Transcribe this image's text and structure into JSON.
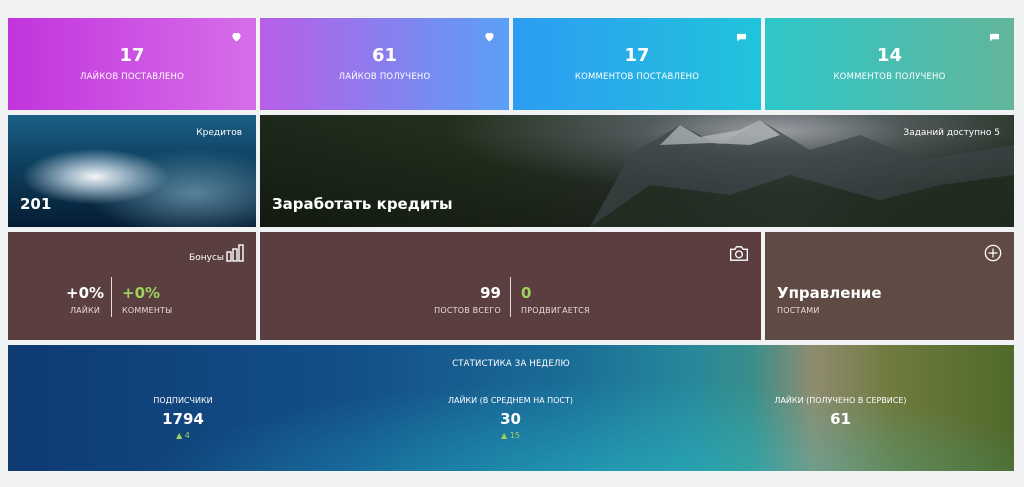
{
  "stats": [
    {
      "value": "17",
      "label": "ЛАЙКОВ ПОСТАВЛЕНО",
      "icon": "heart-icon"
    },
    {
      "value": "61",
      "label": "ЛАЙКОВ ПОЛУЧЕНО",
      "icon": "heart-icon"
    },
    {
      "value": "17",
      "label": "КОММЕНТОВ ПОСТАВЛЕНО",
      "icon": "comment-icon"
    },
    {
      "value": "14",
      "label": "КОММЕНТОВ ПОЛУЧЕНО",
      "icon": "comment-icon"
    }
  ],
  "credits": {
    "title": "Кредитов",
    "value": "201"
  },
  "earn": {
    "title": "Заработать кредиты",
    "tasks": "Заданий доступно 5"
  },
  "bonus": {
    "title": "Бонусы",
    "likes_value": "+0%",
    "likes_label": "ЛАЙКИ",
    "comments_value": "+0%",
    "comments_label": "КОММЕНТЫ",
    "icon": "bar-chart-icon"
  },
  "posts": {
    "total_value": "99",
    "total_label": "ПОСТОВ ВСЕГО",
    "promoted_value": "0",
    "promoted_label": "ПРОДВИГАЕТСЯ",
    "icon": "camera-icon"
  },
  "manage": {
    "title": "Управление",
    "subtitle": "ПОСТАМИ",
    "icon": "plus-circle-icon"
  },
  "weekly": {
    "title": "СТАТИСТИКА ЗА НЕДЕЛЮ",
    "items": [
      {
        "label": "ПОДПИСЧИКИ",
        "value": "1794",
        "delta": "4"
      },
      {
        "label": "ЛАЙКИ (В СРЕДНЕМ НА ПОСТ)",
        "value": "30",
        "delta": "15"
      },
      {
        "label": "ЛАЙКИ (ПОЛУЧЕНО В СЕРВИСЕ)",
        "value": "61",
        "delta": ""
      }
    ]
  },
  "colors": {
    "accent_green": "#9ed25c",
    "tile_brown": "#5b3e3f"
  }
}
